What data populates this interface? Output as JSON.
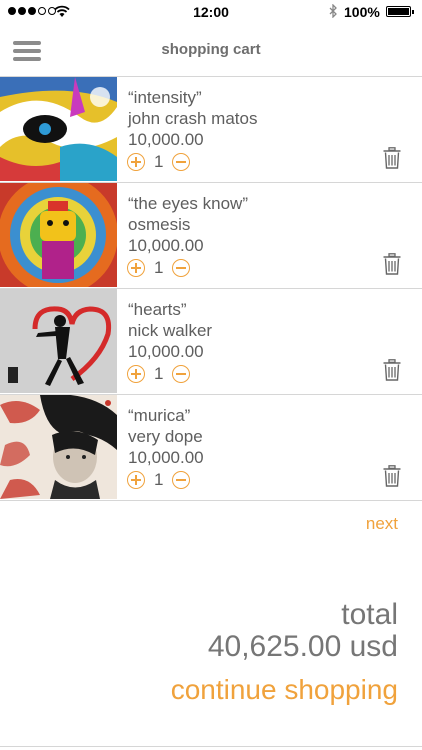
{
  "status_bar": {
    "time": "12:00",
    "battery": "100%"
  },
  "header": {
    "title": "shopping cart"
  },
  "cart": {
    "items": [
      {
        "title": "“intensity”",
        "artist": "john crash matos",
        "price": "10,000.00",
        "quantity": "1"
      },
      {
        "title": "“the eyes know”",
        "artist": "osmesis",
        "price": "10,000.00",
        "quantity": "1"
      },
      {
        "title": "“hearts”",
        "artist": "nick walker",
        "price": "10,000.00",
        "quantity": "1"
      },
      {
        "title": "“murica”",
        "artist": "very dope",
        "price": "10,000.00",
        "quantity": "1"
      }
    ]
  },
  "next_label": "next",
  "summary": {
    "total_label": "total",
    "total_value": "40,625.00 usd"
  },
  "continue_label": "continue shopping",
  "colors": {
    "accent": "#f0a23c",
    "text": "#5e5e5e",
    "divider": "#d6d6d6"
  }
}
